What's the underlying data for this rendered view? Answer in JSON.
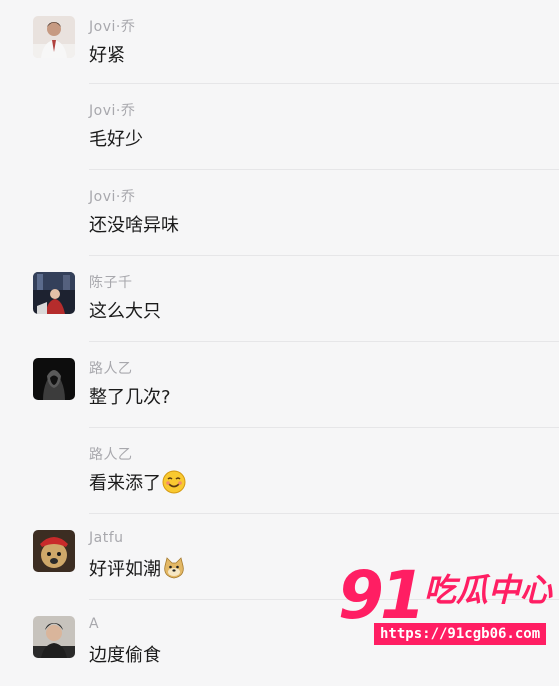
{
  "messages": [
    {
      "author": "Jovi·乔",
      "text": "好紧",
      "avatar": "avatar-jovi"
    },
    {
      "author": "Jovi·乔",
      "text": "毛好少",
      "avatar": null
    },
    {
      "author": "Jovi·乔",
      "text": "还没啥异味",
      "avatar": null
    },
    {
      "author": "陈子千",
      "text": "这么大只",
      "avatar": "avatar-chenziqian"
    },
    {
      "author": "路人乙",
      "text": "整了几次?",
      "avatar": "avatar-lurenyi"
    },
    {
      "author": "路人乙",
      "text": "看来添了",
      "avatar": null,
      "emoji": "sly-smile-emoji"
    },
    {
      "author": "Jatfu",
      "text": "好评如潮",
      "avatar": "avatar-jatfu",
      "emoji": "doge-emoji"
    },
    {
      "author": "A",
      "text": "边度偷食",
      "avatar": "avatar-a"
    }
  ],
  "watermark": {
    "number": "91",
    "title": "吃瓜中心",
    "url": "https://91cgb06.com",
    "color": "#ff1e63"
  },
  "colors": {
    "background": "#f6f6f7",
    "author": "#a8a8ad",
    "text": "#1b1b1b"
  }
}
